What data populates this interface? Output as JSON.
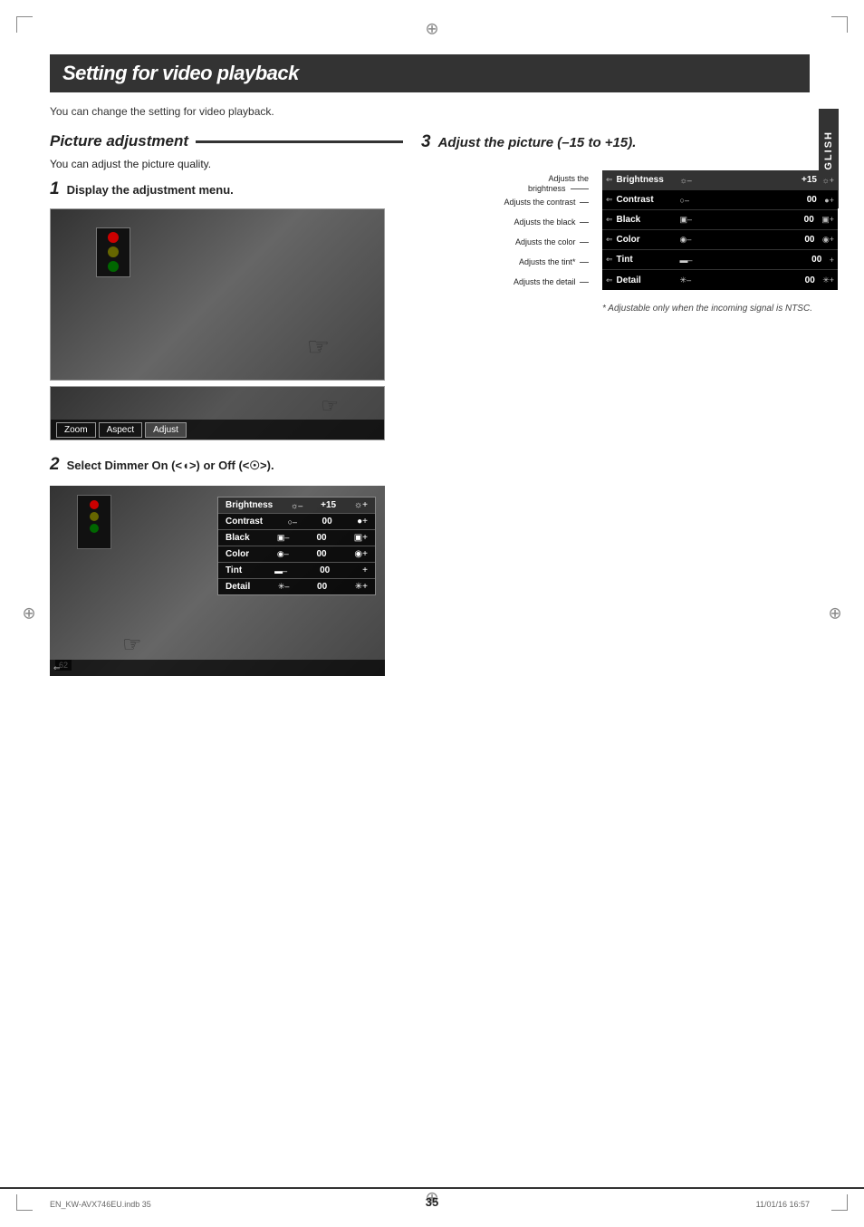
{
  "page": {
    "title": "Setting for video playback",
    "subtitle": "You can change the setting for video playback.",
    "page_number": "35",
    "footer_file": "EN_KW-AVX746EU.indb  35",
    "footer_date": "11/01/16  16:57"
  },
  "sidebar": {
    "label": "ENGLISH"
  },
  "picture_adjustment": {
    "heading": "Picture adjustment",
    "description": "You can adjust the picture quality.",
    "step1": {
      "number": "1",
      "label": "Display the adjustment menu."
    },
    "step2": {
      "number": "2",
      "label": "Select Dimmer On (<◖>) or Off (<☉>)."
    },
    "step3": {
      "number": "3",
      "label": "Adjust the picture (–15 to +15)."
    }
  },
  "tabs": [
    "Zoom",
    "Aspect",
    "Adjust"
  ],
  "adjustment_rows": [
    {
      "name": "Brightness",
      "value": "+15",
      "label_left": "Adjusts the brightness"
    },
    {
      "name": "Contrast",
      "value": "00",
      "label_left": "Adjusts the contrast"
    },
    {
      "name": "Black",
      "value": "00",
      "label_left": "Adjusts the black"
    },
    {
      "name": "Color",
      "value": "00",
      "label_left": "Adjusts the color"
    },
    {
      "name": "Tint",
      "value": "00",
      "label_left": "Adjusts the tint*"
    },
    {
      "name": "Detail",
      "value": "00",
      "label_left": "Adjusts the detail"
    }
  ],
  "footnote": "* Adjustable only when the incoming signal is NTSC."
}
